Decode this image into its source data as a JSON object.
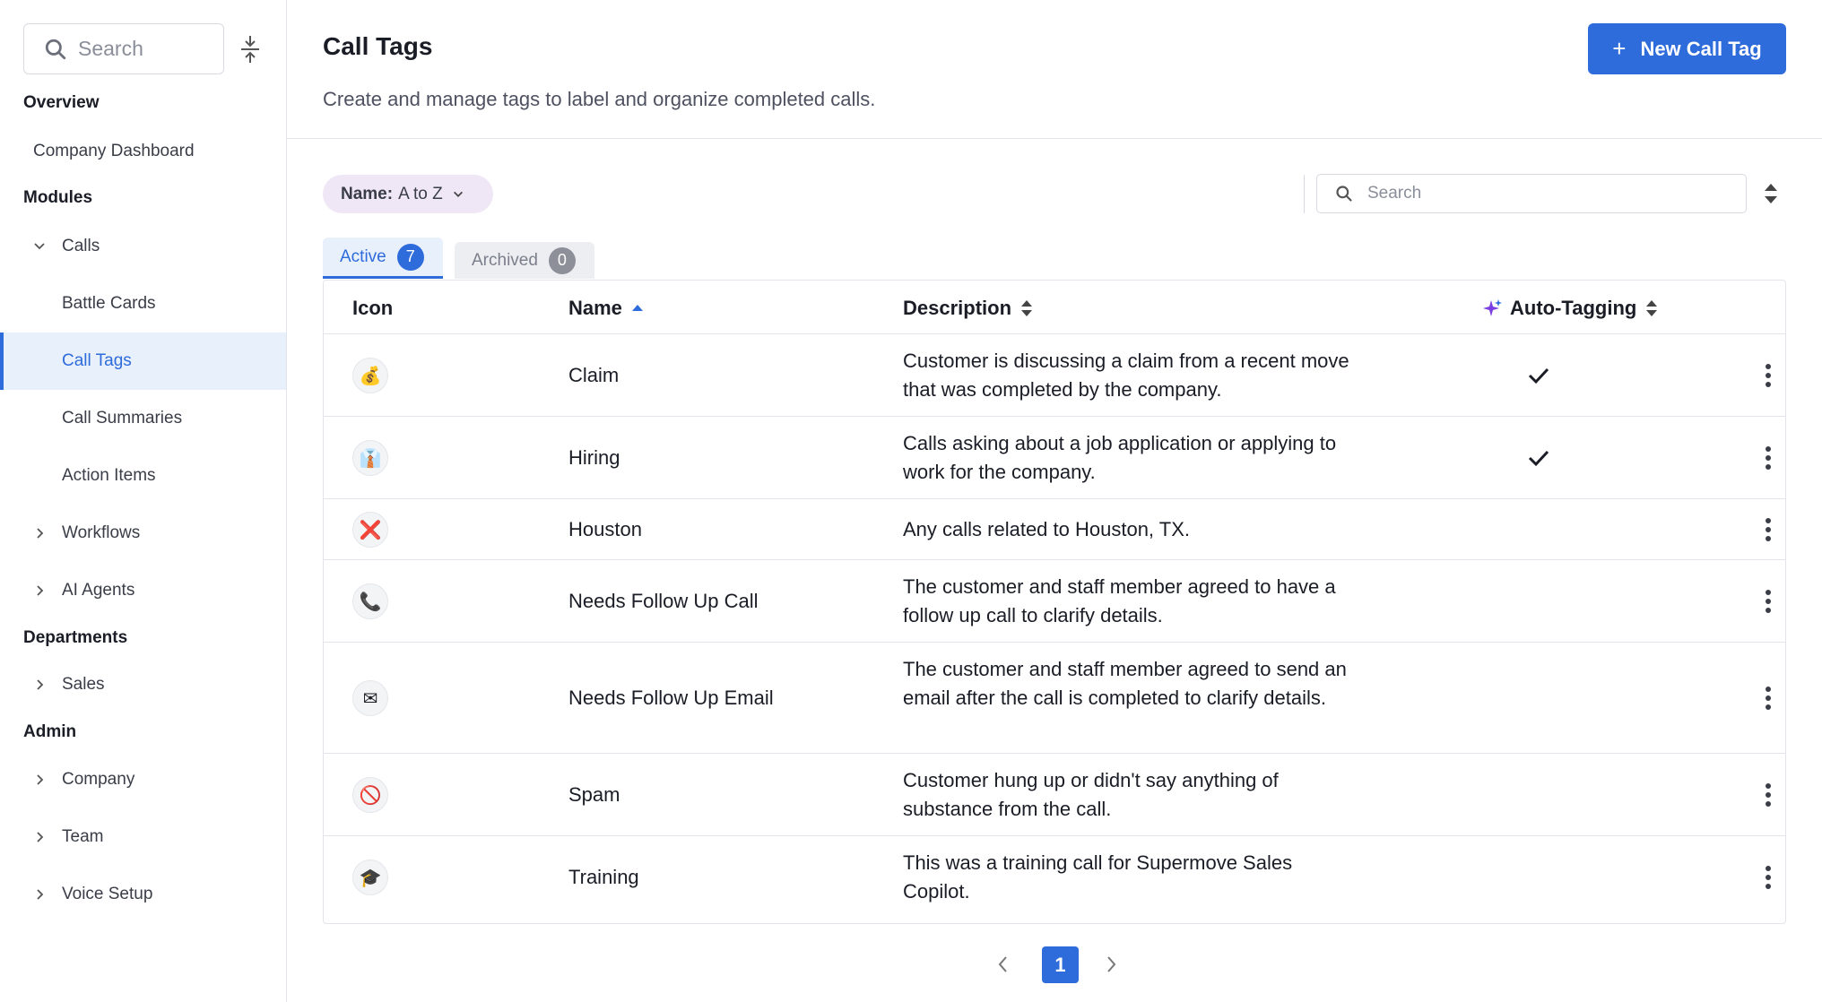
{
  "sidebar": {
    "search_placeholder": "Search",
    "sections": {
      "overview": "Overview",
      "modules": "Modules",
      "departments": "Departments",
      "admin": "Admin"
    },
    "items": {
      "company_dashboard": "Company Dashboard",
      "calls": "Calls",
      "battle_cards": "Battle Cards",
      "call_tags": "Call Tags",
      "call_summaries": "Call Summaries",
      "action_items": "Action Items",
      "workflows": "Workflows",
      "ai_agents": "AI Agents",
      "sales": "Sales",
      "company": "Company",
      "team": "Team",
      "voice_setup": "Voice Setup"
    }
  },
  "header": {
    "title": "Call Tags",
    "subtitle": "Create and manage tags to label and organize completed calls.",
    "new_button": "New Call Tag",
    "new_button_icon": "+"
  },
  "toolbar": {
    "sort_label": "Name:",
    "sort_value": "A to Z",
    "search_placeholder": "Search"
  },
  "tabs": {
    "active_label": "Active",
    "active_count": "7",
    "archived_label": "Archived",
    "archived_count": "0"
  },
  "table": {
    "columns": {
      "icon": "Icon",
      "name": "Name",
      "description": "Description",
      "auto_tagging": "Auto-Tagging"
    },
    "rows": [
      {
        "icon": "💰",
        "icon_name": "money-bag-icon",
        "name": "Claim",
        "description": "Customer is discussing a claim from a recent move that was completed by the company.",
        "auto_tagging": true
      },
      {
        "icon": "👔",
        "icon_name": "worker-icon",
        "name": "Hiring",
        "description": "Calls asking about a job application or applying to work for the company.",
        "auto_tagging": true
      },
      {
        "icon": "❌",
        "icon_name": "red-x-icon",
        "name": "Houston",
        "description": "Any calls related to Houston, TX.",
        "auto_tagging": false
      },
      {
        "icon": "📞",
        "icon_name": "phone-icon",
        "name": "Needs Follow Up Call",
        "description": "The customer and staff member agreed to have a follow up call to clarify details.",
        "auto_tagging": false
      },
      {
        "icon": "✉",
        "icon_name": "envelope-icon",
        "name": "Needs Follow Up Email",
        "description": "The customer and staff member agreed to send an email after the call is completed to clarify details.",
        "auto_tagging": false
      },
      {
        "icon": "🚫",
        "icon_name": "no-entry-icon",
        "name": "Spam",
        "description": "Customer hung up or didn't say anything of substance from the call.",
        "auto_tagging": false
      },
      {
        "icon": "🎓",
        "icon_name": "graduation-cap-icon",
        "name": "Training",
        "description": "This was a training call for Supermove Sales Copilot.",
        "auto_tagging": false
      }
    ]
  },
  "pagination": {
    "current_page": "1"
  },
  "colors": {
    "accent": "#2e6bdb",
    "active_nav_bg": "#e8f0fc",
    "sort_pill_bg": "#efe7f6",
    "sparkle": "#7b3fe4"
  }
}
